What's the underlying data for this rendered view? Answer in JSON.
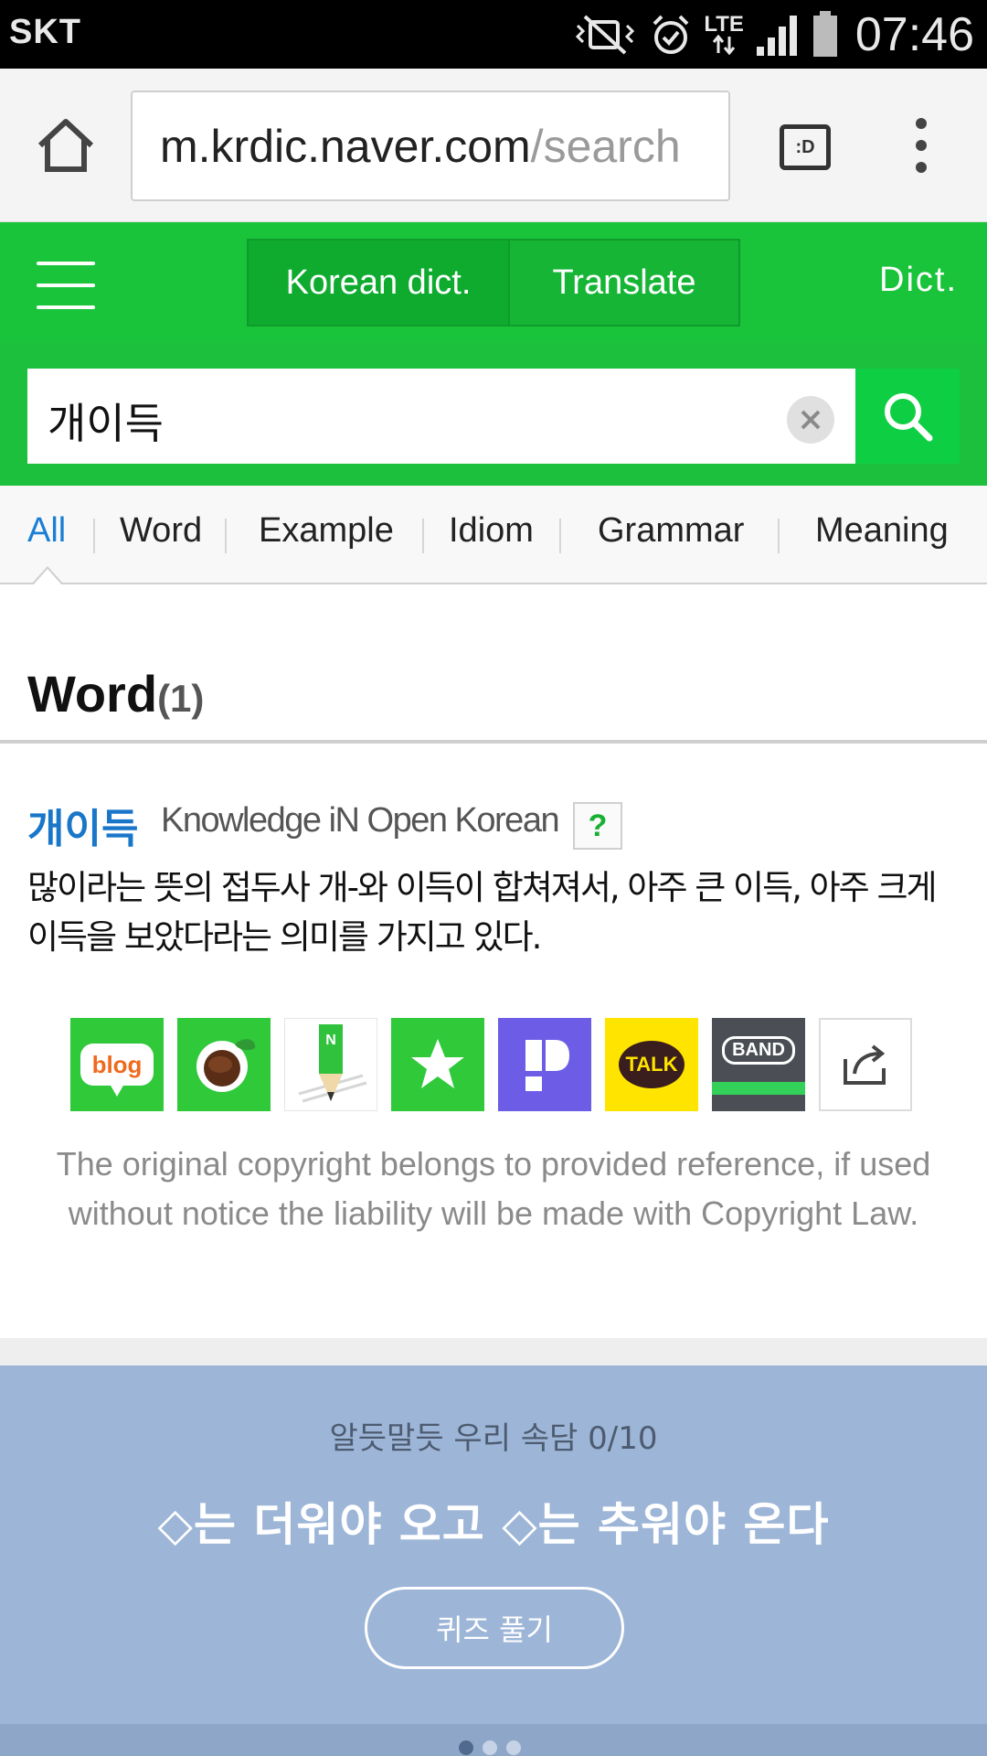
{
  "status_bar": {
    "carrier": "SKT",
    "network": "LTE",
    "time": "07:46",
    "icons": [
      "mute-vibrate-icon",
      "alarm-icon",
      "lte-icon",
      "signal-icon",
      "battery-icon"
    ]
  },
  "browser": {
    "url_host": "m.krdic.naver.com",
    "url_path": "/search",
    "reader_icon_label": ":D"
  },
  "nav": {
    "tabs": [
      {
        "label": "Korean dict."
      },
      {
        "label": "Translate"
      }
    ],
    "dict_link": "Dict."
  },
  "search": {
    "query": "개이득"
  },
  "filters": {
    "active": "All",
    "items": [
      "All",
      "Word",
      "Example",
      "Idiom",
      "Grammar",
      "Meaning"
    ]
  },
  "word_section": {
    "title": "Word",
    "count": "(1)"
  },
  "entry": {
    "word": "개이득",
    "source": "Knowledge iN Open Korean",
    "help_label": "?",
    "definition": "많이라는 뜻의 접두사 개-와 이득이 합쳐져서, 아주 큰 이득, 아주 크게 이득을 보았다라는 의미를 가지고 있다."
  },
  "share": {
    "blog_label": "blog",
    "talk_label": "TALK",
    "band_label": "BAND"
  },
  "copyright": "The original copyright belongs to provided reference, if used without notice the liability will be made with Copyright Law.",
  "quiz": {
    "subtitle": "알듯말듯 우리 속담 0/10",
    "question": "◇는 더워야 오고 ◇는 추워야 온다",
    "button": "퀴즈 풀기"
  },
  "colors": {
    "brand_green": "#19c43a",
    "link_blue": "#1976c9",
    "quiz_bg": "#9db5d7"
  }
}
